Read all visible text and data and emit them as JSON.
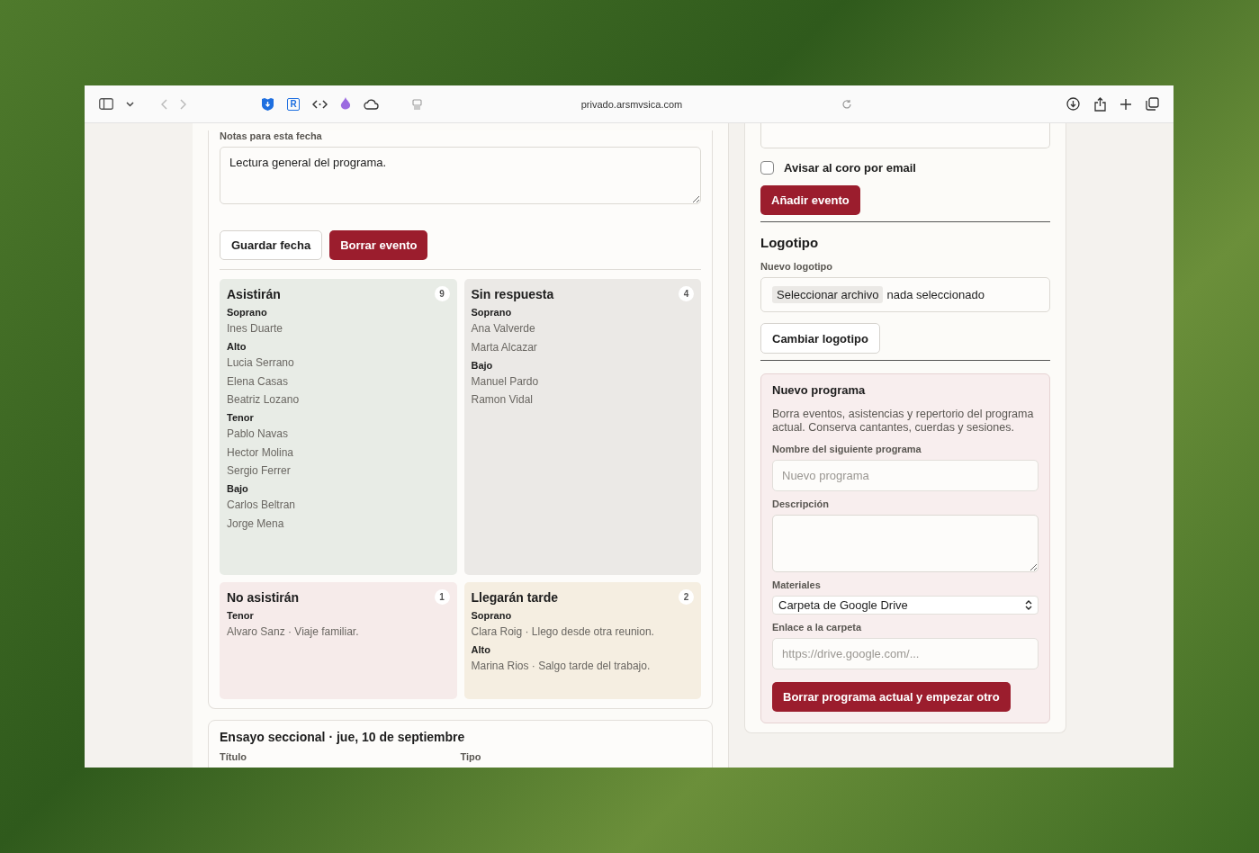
{
  "browser": {
    "url": "privado.arsmvsica.com",
    "extension_badge": "R"
  },
  "notes": {
    "label": "Notas para esta fecha",
    "value": "Lectura general del programa."
  },
  "actions": [
    {
      "label": "Guardar fecha",
      "kind": "secondary"
    },
    {
      "label": "Borrar evento",
      "kind": "danger"
    }
  ],
  "groups": [
    {
      "title": "Asistirán",
      "count": "9",
      "color": "#e8ece6",
      "sections": [
        {
          "voice": "Soprano",
          "names": [
            "Ines Duarte"
          ]
        },
        {
          "voice": "Alto",
          "names": [
            "Lucia Serrano",
            "Elena Casas",
            "Beatriz Lozano"
          ]
        },
        {
          "voice": "Tenor",
          "names": [
            "Pablo Navas",
            "Hector Molina",
            "Sergio Ferrer"
          ]
        },
        {
          "voice": "Bajo",
          "names": [
            "Carlos Beltran",
            "Jorge Mena"
          ]
        }
      ]
    },
    {
      "title": "Sin respuesta",
      "count": "4",
      "color": "#ebe9e6",
      "sections": [
        {
          "voice": "Soprano",
          "names": [
            "Ana Valverde",
            "Marta Alcazar"
          ]
        },
        {
          "voice": "Bajo",
          "names": [
            "Manuel Pardo",
            "Ramon Vidal"
          ]
        }
      ]
    },
    {
      "title": "No asistirán",
      "count": "1",
      "color": "#f6ebea",
      "sections": [
        {
          "voice": "Tenor",
          "names": [
            "Alvaro Sanz · Viaje familiar."
          ]
        }
      ]
    },
    {
      "title": "Llegarán tarde",
      "count": "2",
      "color": "#f5eee1",
      "sections": [
        {
          "voice": "Soprano",
          "names": [
            "Clara Roig · Llego desde otra reunion."
          ]
        },
        {
          "voice": "Alto",
          "names": [
            "Marina Rios · Salgo tarde del trabajo."
          ]
        }
      ]
    }
  ],
  "next_event": {
    "title": "Ensayo seccional · jue, 10 de septiembre",
    "columns": [
      "Título",
      "Tipo"
    ]
  },
  "notify": {
    "label": "Avisar al coro por email",
    "checked": false
  },
  "add_button": "Añadir evento",
  "logo": {
    "heading": "Logotipo",
    "field_label": "Nuevo logotipo",
    "file_button": "Seleccionar archivo",
    "file_status": "nada seleccionado",
    "button": "Cambiar logotipo"
  },
  "new_program": {
    "title": "Nuevo programa",
    "description": "Borra eventos, asistencias y repertorio del programa actual. Conserva cantantes, cuerdas y sesiones.",
    "name_label": "Nombre del siguiente programa",
    "name_placeholder": "Nuevo programa",
    "desc_label": "Descripción",
    "materials_label": "Materiales",
    "materials_value": "Carpeta de Google Drive",
    "link_label": "Enlace a la carpeta",
    "link_placeholder": "https://drive.google.com/...",
    "button": "Borrar programa actual y empezar otro"
  }
}
